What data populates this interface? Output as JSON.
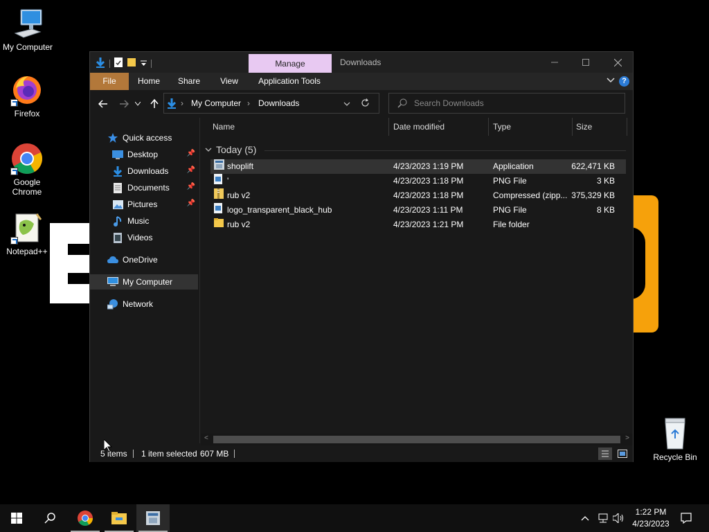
{
  "desktop": {
    "icons": [
      {
        "label": "My Computer",
        "icon": "computer-icon"
      },
      {
        "label": "Firefox",
        "icon": "firefox-icon"
      },
      {
        "label": "Google Chrome",
        "icon": "chrome-icon"
      },
      {
        "label": "Notepad++",
        "icon": "notepadpp-icon"
      },
      {
        "label": "Recycle Bin",
        "icon": "recycle-bin-icon"
      }
    ]
  },
  "window": {
    "title": "Downloads",
    "contextual_tab": "Manage",
    "ribbon_tabs": [
      "File",
      "Home",
      "Share",
      "View",
      "Application Tools"
    ],
    "breadcrumb": [
      "My Computer",
      "Downloads"
    ],
    "search_placeholder": "Search Downloads",
    "nav_pane": [
      {
        "label": "Quick access",
        "icon": "star-icon",
        "pinned": false
      },
      {
        "label": "Desktop",
        "icon": "desktop-folder-icon",
        "pinned": true
      },
      {
        "label": "Downloads",
        "icon": "download-arrow-icon",
        "pinned": true
      },
      {
        "label": "Documents",
        "icon": "document-icon",
        "pinned": true
      },
      {
        "label": "Pictures",
        "icon": "picture-icon",
        "pinned": true
      },
      {
        "label": "Music",
        "icon": "music-note-icon",
        "pinned": false
      },
      {
        "label": "Videos",
        "icon": "video-icon",
        "pinned": false
      },
      {
        "label": "OneDrive",
        "icon": "cloud-icon",
        "pinned": false
      },
      {
        "label": "My Computer",
        "icon": "computer-icon",
        "pinned": false,
        "selected": true
      },
      {
        "label": "Network",
        "icon": "network-icon",
        "pinned": false
      }
    ],
    "columns": [
      "Name",
      "Date modified",
      "Type",
      "Size"
    ],
    "group_header": "Today (5)",
    "files": [
      {
        "name": "shoplift",
        "date": "4/23/2023 1:19 PM",
        "type": "Application",
        "size": "622,471 KB",
        "icon": "application-icon",
        "selected": true
      },
      {
        "name": "'",
        "date": "4/23/2023 1:18 PM",
        "type": "PNG File",
        "size": "3 KB",
        "icon": "png-file-icon"
      },
      {
        "name": "rub v2",
        "date": "4/23/2023 1:18 PM",
        "type": "Compressed (zipp...",
        "size": "375,329 KB",
        "icon": "zip-folder-icon"
      },
      {
        "name": "logo_transparent_black_hub",
        "date": "4/23/2023 1:11 PM",
        "type": "PNG File",
        "size": "8 KB",
        "icon": "png-file-icon"
      },
      {
        "name": "rub v2",
        "date": "4/23/2023 1:21 PM",
        "type": "File folder",
        "size": "",
        "icon": "folder-icon"
      }
    ],
    "status": {
      "items": "5 items",
      "selection": "1 item selected",
      "size": "607 MB"
    }
  },
  "taskbar": {
    "time": "1:22 PM",
    "date": "4/23/2023"
  },
  "colors": {
    "window_bg": "#191919",
    "file_tab": "#b3783a",
    "manage_tab": "#e8c9f2",
    "accent_blue": "#2b7bd6",
    "wallpaper_orange": "#f6a10b"
  }
}
